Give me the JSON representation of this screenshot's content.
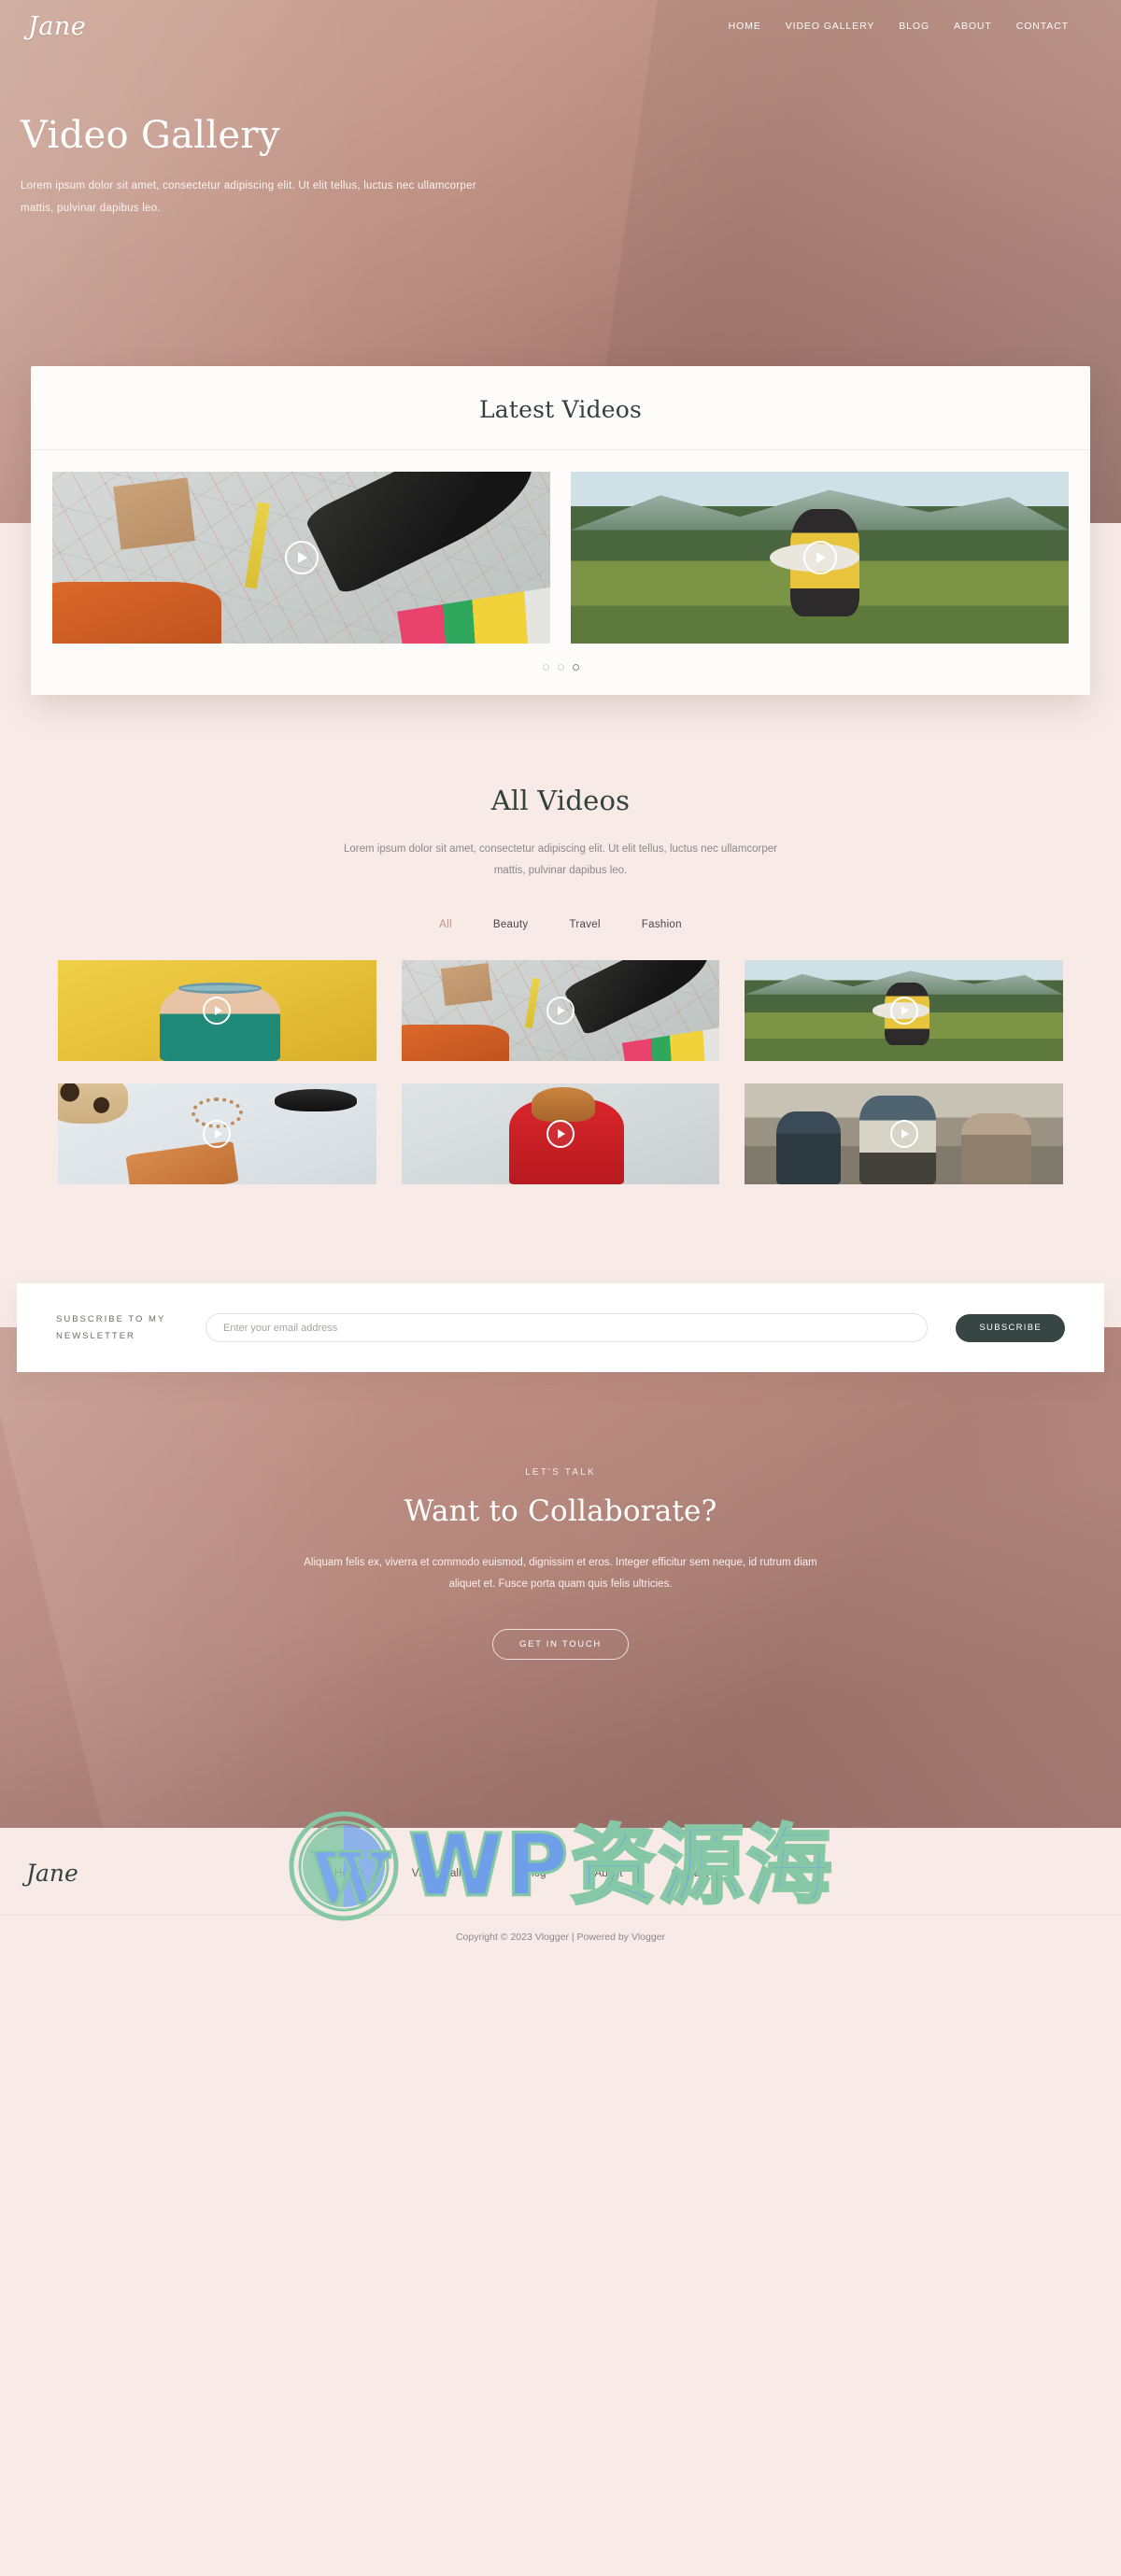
{
  "site": {
    "brand": "Jane",
    "background_color": "#f8ebe7",
    "accent_color": "#c58f88",
    "dark_color": "#374643"
  },
  "header": {
    "logo": "Jane",
    "nav": [
      {
        "label": "HOME"
      },
      {
        "label": "VIDEO GALLERY"
      },
      {
        "label": "BLOG"
      },
      {
        "label": "ABOUT"
      },
      {
        "label": "CONTACT"
      }
    ]
  },
  "hero": {
    "title": "Video Gallery",
    "description": "Lorem ipsum dolor sit amet, consectetur adipiscing elit. Ut elit tellus, luctus nec ullamcorper mattis, pulvinar dapibus leo."
  },
  "latest": {
    "heading": "Latest Videos",
    "slides": [
      {
        "alt": "Flat lay of map, field notes journal, pencil, camera lens and orange backpack",
        "play_icon": "play-icon"
      },
      {
        "alt": "Hiker with backpack and hat looking at mountain meadow",
        "play_icon": "play-icon"
      }
    ],
    "dots": [
      {
        "active": false
      },
      {
        "active": false
      },
      {
        "active": true
      }
    ]
  },
  "all_videos": {
    "heading": "All Videos",
    "description": "Lorem ipsum dolor sit amet, consectetur adipiscing elit. Ut elit tellus, luctus nec ullamcorper mattis, pulvinar dapibus leo.",
    "filters": [
      {
        "label": "All",
        "active": true
      },
      {
        "label": "Beauty",
        "active": false
      },
      {
        "label": "Travel",
        "active": false
      },
      {
        "label": "Fashion",
        "active": false
      }
    ],
    "tiles": [
      {
        "alt": "Woman with large sunglasses against yellow wall",
        "play_icon": "play-icon"
      },
      {
        "alt": "Map flat lay with field notes, pencil and camera",
        "play_icon": "play-icon"
      },
      {
        "alt": "Hiker with hat in green mountain valley",
        "play_icon": "play-icon"
      },
      {
        "alt": "Flat lay with leopard print, sunglasses, beads and leather wallet",
        "play_icon": "play-icon"
      },
      {
        "alt": "Woman in red Tomato Soup sweatshirt",
        "play_icon": "play-icon"
      },
      {
        "alt": "Group of friends hiking with backpacks",
        "play_icon": "play-icon"
      }
    ]
  },
  "newsletter": {
    "label": "SUBSCRIBE TO MY NEWSLETTER",
    "placeholder": "Enter your email address",
    "value": "",
    "button": "SUBSCRIBE"
  },
  "collaborate": {
    "eyebrow": "LET'S TALK",
    "heading": "Want to Collaborate?",
    "description": "Aliquam felis ex, viverra et commodo euismod, dignissim et eros. Integer efficitur sem neque, id rutrum diam aliquet et. Fusce porta quam quis felis ultricies.",
    "button": "GET IN TOUCH"
  },
  "footer": {
    "logo": "Jane",
    "nav": [
      {
        "label": "Home"
      },
      {
        "label": "Video Gallery"
      },
      {
        "label": "Blog"
      },
      {
        "label": "About"
      },
      {
        "label": "Contact"
      }
    ],
    "copyright": "Copyright © 2023 Vlogger | Powered by Vlogger"
  },
  "watermark": {
    "text": "WP资源海",
    "logo_icon": "wordpress-icon"
  }
}
